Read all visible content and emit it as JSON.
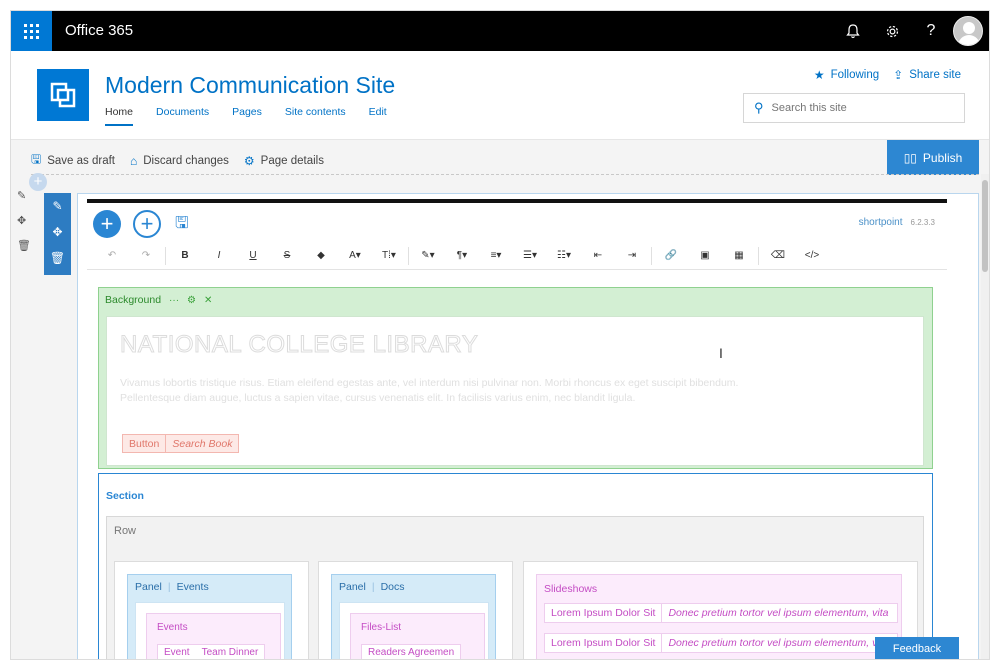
{
  "suite": {
    "title": "Office 365",
    "icons": [
      "bell-icon",
      "gear-icon",
      "help-icon",
      "avatar"
    ]
  },
  "site": {
    "title": "Modern Communication Site",
    "nav": [
      "Home",
      "Documents",
      "Pages",
      "Site contents",
      "Edit"
    ],
    "following_label": "Following",
    "share_label": "Share site",
    "search_placeholder": "Search this site"
  },
  "commands": {
    "save_draft": "Save as draft",
    "discard": "Discard changes",
    "page_details": "Page details",
    "publish": "Publish"
  },
  "shortpoint": {
    "brand": "shortpoint",
    "version": "6.2.3.3",
    "toolbar": [
      "↶",
      "↷",
      "B",
      "I",
      "U",
      "S",
      "◆",
      "A▾",
      "T⁞▾",
      "✎▾",
      "¶▾",
      "≡▾",
      "☰▾",
      "☷▾",
      "⇤",
      "⇥",
      "🔗",
      "▣",
      "▦",
      "⌫",
      "</>"
    ]
  },
  "background": {
    "label": "Background",
    "title": "NATIONAL COLLEGE LIBRARY",
    "text": "Vivamus lobortis tristique risus. Etiam eleifend egestas ante, vel interdum nisi pulvinar non. Morbi rhoncus ex eget suscipit bibendum. Pellentesque diam augue, luctus a sapien vitae, cursus venenatis elit. In facilisis varius enim, nec blandit ligula.",
    "button_label": "Button",
    "button_text": "Search Book"
  },
  "section": {
    "label": "Section",
    "row_label": "Row",
    "panel1": {
      "label": "Panel",
      "name": "Events",
      "inner": "Events",
      "item1": "Event",
      "item2": "Team Dinner"
    },
    "panel2": {
      "label": "Panel",
      "name": "Docs",
      "inner": "Files-List",
      "item1": "Readers Agreemen"
    },
    "slideshows": {
      "label": "Slideshows",
      "rows": [
        {
          "title": "Lorem Ipsum Dolor Sit",
          "text": "Donec pretium tortor vel ipsum elementum, vita"
        },
        {
          "title": "Lorem Ipsum Dolor Sit",
          "text": "Donec pretium tortor vel ipsum elementum, vita"
        }
      ]
    }
  },
  "feedback": "Feedback",
  "colors": {
    "accent": "#0078d4",
    "publish": "#2d87d2",
    "background_section": "#d3efd3",
    "section_border": "#2a86d3"
  }
}
